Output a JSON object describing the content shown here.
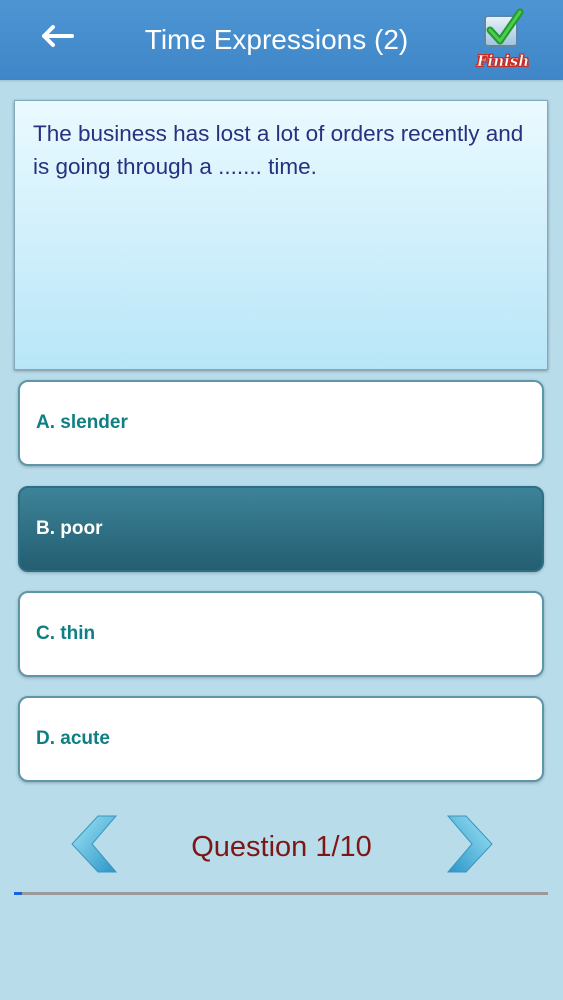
{
  "header": {
    "title": "Time Expressions (2)",
    "back_icon": "back-arrow-icon",
    "finish_label": "Finish",
    "finish_icon": "checkbox-check-icon"
  },
  "question": {
    "text": "The business has lost a lot of orders recently and is going through a ....... time."
  },
  "answers": [
    {
      "label": "A. slender",
      "selected": false
    },
    {
      "label": "B. poor",
      "selected": true
    },
    {
      "label": "C. thin",
      "selected": false
    },
    {
      "label": "D. acute",
      "selected": false
    }
  ],
  "navigation": {
    "prev_icon": "chevron-left-icon",
    "next_icon": "chevron-right-icon",
    "counter": "Question 1/10",
    "progress": 0.015
  },
  "colors": {
    "header_bg": "#4590d0",
    "page_bg": "#b9dceb",
    "answer_text": "#0f7f83",
    "selected_bg": "#2f6f85",
    "counter_text": "#7d1717",
    "progress_fill": "#1565e0"
  }
}
